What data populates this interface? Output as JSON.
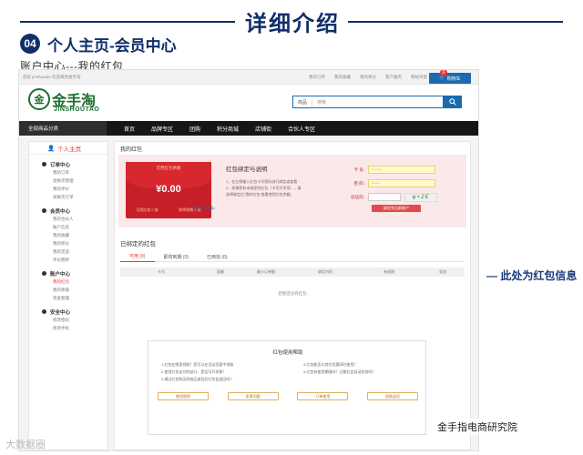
{
  "slide": {
    "title": "详细介绍",
    "section_number": "04",
    "section_title": "个人主页-会员中心",
    "subtitle": "账户中心---我的红包",
    "callout": "— 此处为红包信息",
    "watermark_left": "大数据圈",
    "watermark_right": "金手指电商研究院"
  },
  "site": {
    "topbar": {
      "welcome": "您好 jinshoutao 欢迎来到金手淘",
      "links": [
        "我的订单",
        "我的收藏",
        "我的积分",
        "客户服务",
        "网站导航"
      ],
      "cart_label": "购物车",
      "cart_count": "0"
    },
    "logo_cn": "金手淘",
    "logo_en": "JINSHOUTAO",
    "search": {
      "category": "商品",
      "placeholder": "搜索"
    },
    "nav": {
      "category_label": "全部商品分类",
      "items": [
        "首页",
        "品牌专区",
        "团购",
        "积分商城",
        "店铺街",
        "合伙人专区"
      ]
    }
  },
  "sidebar": {
    "home": "个人主页",
    "groups": [
      {
        "title": "订单中心",
        "items": [
          "我的订单",
          "退换货管理",
          "我的评价",
          "退换货订单"
        ]
      },
      {
        "title": "会员中心",
        "items": [
          "我的合伙人",
          "账户信息",
          "我的收藏",
          "我的积分",
          "我的足迹",
          "评论晒单"
        ]
      },
      {
        "title": "账户中心",
        "items": [
          "我的红包",
          "我的余额",
          "资金管理"
        ]
      },
      {
        "title": "安全中心",
        "items": [
          "修改密码",
          "修改手机"
        ]
      }
    ],
    "active_item": "我的红包"
  },
  "main": {
    "title": "我的红包",
    "card": {
      "label": "可用红包余额",
      "amount": "¥0.00",
      "foot_left": "可用红包 0 张",
      "foot_right": "即将到期 0 张"
    },
    "rules": {
      "title": "红包绑定与说明",
      "lines": [
        "1、在左侧输入红包卡号密码进行绑定或查看",
        "2、如果您有未绑定的红包（卡号为字母），请",
        "选择绑定后“我的红包”查看使用红包余额。"
      ],
      "link": "了解红包详情>"
    },
    "form": {
      "card_label": "卡  号:",
      "card_value": "*******",
      "pwd_label": "密  码:",
      "pwd_value": "******",
      "code_label": "验证码:",
      "captcha": "ѱ+2E",
      "bind_button": "绑定到当前账户"
    },
    "bound_title": "已绑定的红包",
    "tabs": [
      "可用 (0)",
      "即将到期 (0)",
      "已用完 (0)"
    ],
    "table_headers": [
      "卡号",
      "面额",
      "最小订单额",
      "绑定时间",
      "有效期",
      "状态"
    ],
    "empty_message": "您暂还没有红包",
    "guide": {
      "title": "红包使用帮助",
      "left_lines": [
        "1.红包在哪里领取？您可以在活动页面中领取",
        "2.使用红包支付的部分，是否可开发票？",
        "3.通过红包购买的商品退货后红包会返回吗？"
      ],
      "right_lines": [
        "4.红包能否与其它优惠同时使用？",
        "5.红包有使用期限吗？过期后会自动失效吗？"
      ],
      "buttons": [
        "使用规则",
        "发票问题",
        "订单使用",
        "退款返还"
      ]
    }
  }
}
